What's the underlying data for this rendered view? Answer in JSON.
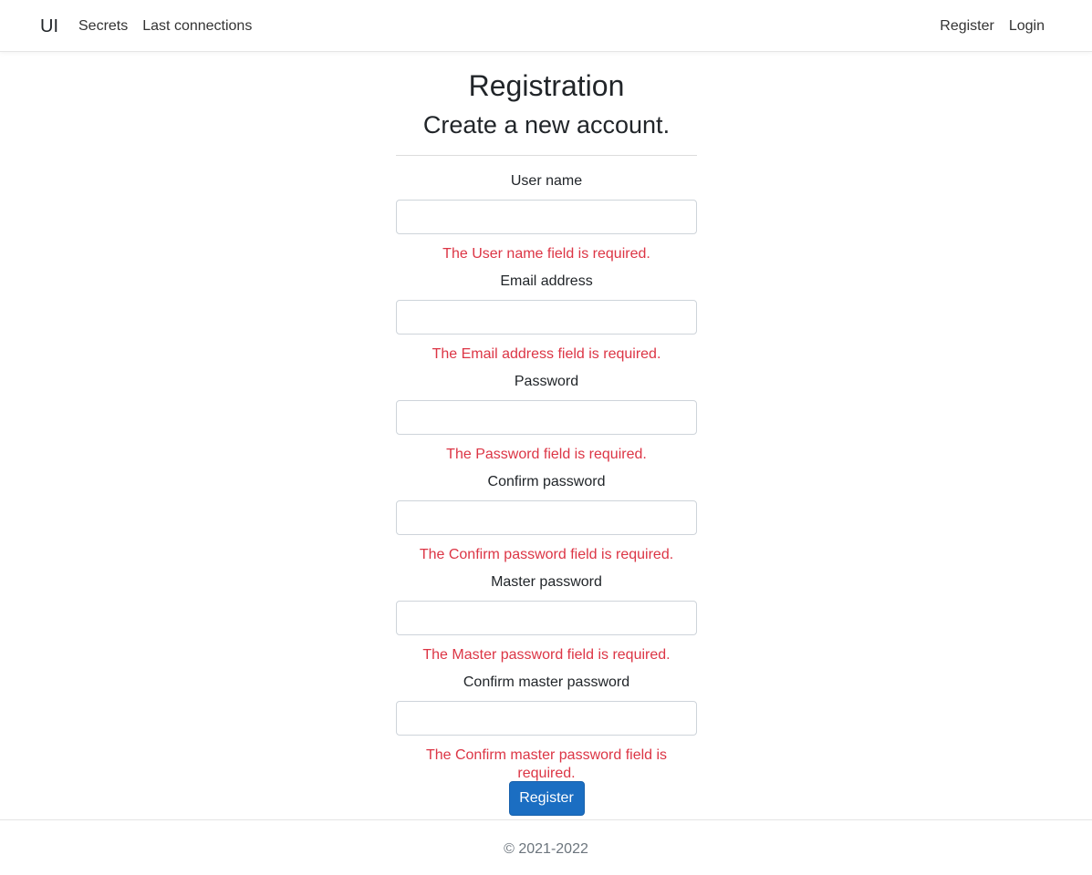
{
  "navbar": {
    "brand": "UI",
    "left_links": [
      {
        "label": "Secrets"
      },
      {
        "label": "Last connections"
      }
    ],
    "right_links": [
      {
        "label": "Register"
      },
      {
        "label": "Login"
      }
    ]
  },
  "page": {
    "title": "Registration",
    "subtitle": "Create a new account."
  },
  "form": {
    "fields": [
      {
        "label": "User name",
        "value": "",
        "error": "The User name field is required."
      },
      {
        "label": "Email address",
        "value": "",
        "error": "The Email address field is required."
      },
      {
        "label": "Password",
        "value": "",
        "error": "The Password field is required."
      },
      {
        "label": "Confirm password",
        "value": "",
        "error": "The Confirm password field is required."
      },
      {
        "label": "Master password",
        "value": "",
        "error": "The Master password field is required."
      },
      {
        "label": "Confirm master password",
        "value": "",
        "error": "The Confirm master password field is required."
      }
    ],
    "submit_label": "Register"
  },
  "footer": {
    "text": "© 2021-2022"
  },
  "colors": {
    "primary": "#1b6ec2",
    "error": "#dc3545",
    "muted": "#6c757d"
  }
}
